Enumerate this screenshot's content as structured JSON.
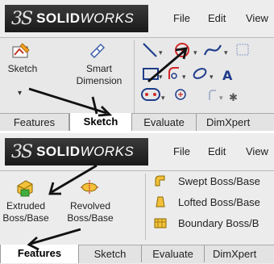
{
  "top": {
    "logo": {
      "ds": "3S",
      "solid": "SOLID",
      "works": "WORKS"
    },
    "menu": [
      "File",
      "Edit",
      "View"
    ],
    "ribbon": {
      "sketch_label": "Sketch",
      "smart_dimension_label": "Smart\nDimension"
    },
    "tabs": [
      "Features",
      "Sketch",
      "Evaluate",
      "DimXpert"
    ],
    "active_tab": "Sketch"
  },
  "bottom": {
    "logo": {
      "ds": "3S",
      "solid": "SOLID",
      "works": "WORKS"
    },
    "menu": [
      "File",
      "Edit",
      "View"
    ],
    "ribbon": {
      "extruded_label": "Extruded\nBoss/Base",
      "revolved_label": "Revolved\nBoss/Base",
      "swept_label": "Swept Boss/Base",
      "lofted_label": "Lofted Boss/Base",
      "boundary_label": "Boundary Boss/B"
    },
    "tabs": [
      "Features",
      "Sketch",
      "Evaluate",
      "DimXpert"
    ],
    "active_tab": "Features"
  },
  "colors": {
    "arrow": "#111111",
    "circle_tool": "#d22828",
    "accent_orange": "#f0a020",
    "sketch_line": "#1f3d8a"
  }
}
